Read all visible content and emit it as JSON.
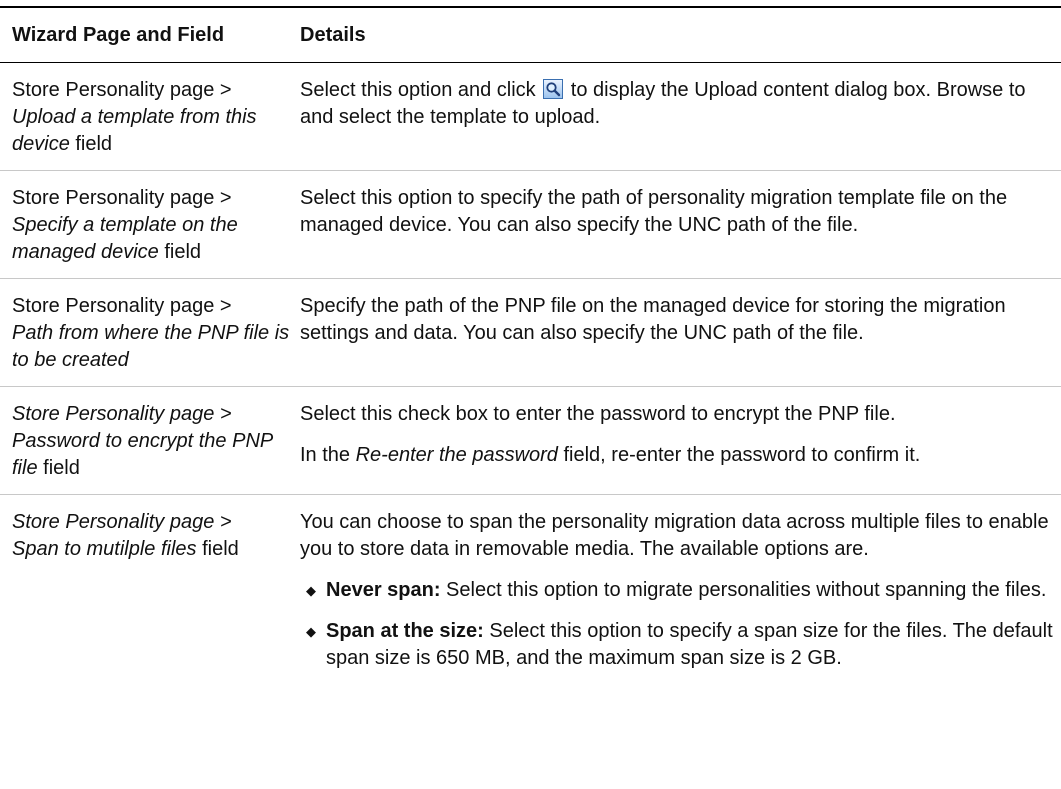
{
  "table": {
    "headers": {
      "field": "Wizard Page and Field",
      "details": "Details"
    },
    "rows": [
      {
        "field": {
          "prefix": "Store Personality page >",
          "name": "Upload a template from this device",
          "suffix": " field"
        },
        "details": {
          "text_before_icon": "Select this option and click ",
          "icon": "search-icon",
          "text_after_icon": " to display the Upload content dialog box. Browse to and select the template to upload."
        }
      },
      {
        "field": {
          "prefix": "Store Personality page >",
          "name": "Specify a template on the managed device",
          "suffix": " field"
        },
        "details": {
          "text": "Select this option to specify the path of personality migration template file on the managed device. You can also specify the UNC path of the file."
        }
      },
      {
        "field": {
          "prefix": "Store Personality page >",
          "name": "Path from where the PNP file is to be created",
          "suffix": ""
        },
        "details": {
          "text": "Specify the path of the PNP file on the managed device for storing the migration settings and data. You can also specify the UNC path of the file."
        }
      },
      {
        "field": {
          "prefix": "Store Personality page >",
          "name": "Password to encrypt the PNP file",
          "suffix": " field"
        },
        "details": {
          "text": "Select this check box to enter the password to encrypt the PNP file.",
          "text2_before": "In the ",
          "text2_italic": "Re-enter the password",
          "text2_after": " field, re-enter the password to confirm it."
        }
      },
      {
        "field": {
          "prefix": "Store Personality page >",
          "name": "Span to mutilple files",
          "suffix": " field"
        },
        "details": {
          "text": "You can choose to span the personality migration data across multiple files to enable you to store data in removable media. The available options are.",
          "bullets": [
            {
              "term": "Never span:",
              "desc": "  Select this option to migrate personalities without spanning the files."
            },
            {
              "term": "Span at the size:",
              "desc": "  Select this option to specify a span size for the files. The default span size is 650 MB, and the maximum span size is 2 GB."
            }
          ]
        }
      }
    ]
  },
  "colors": {
    "rule": "#000000",
    "row_divider": "#c8c8c8",
    "icon_accent": "#3a6fb0"
  }
}
